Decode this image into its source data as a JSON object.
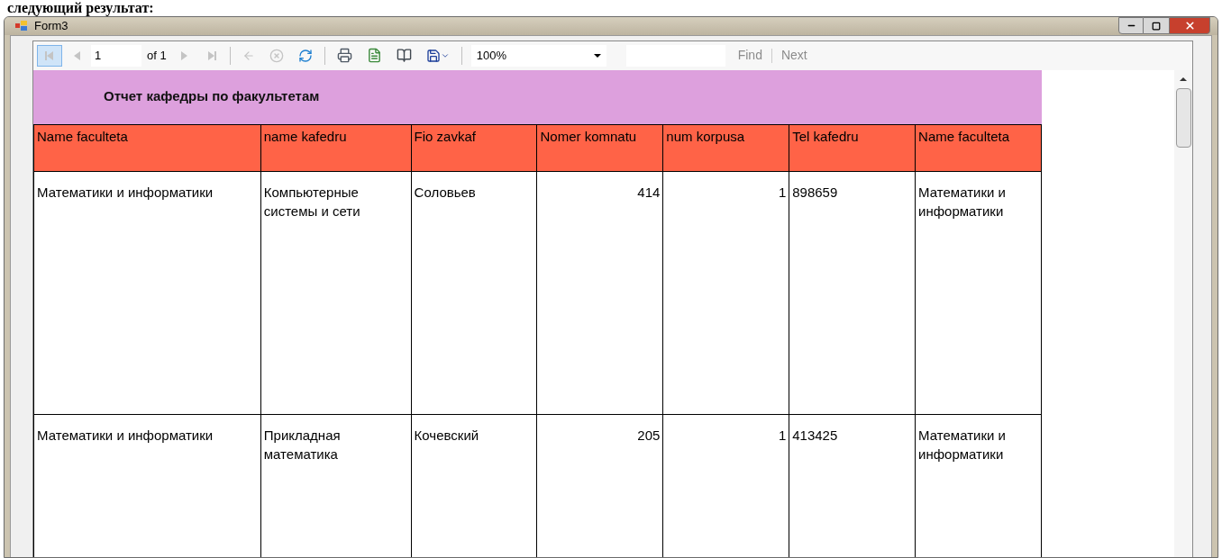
{
  "page_caption": "следующий результат:",
  "window": {
    "title": "Form3"
  },
  "toolbar": {
    "nav_buttons": [
      {
        "kind": "first",
        "disabled": true,
        "highlighted": true
      },
      {
        "kind": "prev",
        "disabled": true,
        "highlighted": false
      }
    ],
    "page_number": "1",
    "page_count": "of 1",
    "buttons": [
      {
        "kind": "next",
        "disabled": true
      },
      {
        "kind": "last",
        "disabled": true
      },
      {
        "kind": "separator"
      },
      {
        "kind": "back",
        "disabled": true
      },
      {
        "kind": "stop",
        "disabled": true
      },
      {
        "kind": "refresh",
        "disabled": false
      },
      {
        "kind": "separator"
      },
      {
        "kind": "print",
        "disabled": false
      },
      {
        "kind": "layout",
        "disabled": false
      },
      {
        "kind": "page_setup",
        "disabled": false
      },
      {
        "kind": "export",
        "disabled": false
      },
      {
        "kind": "separator"
      }
    ],
    "zoom": "100%",
    "find": "Find",
    "next": "Next",
    "find_disabled": true
  },
  "report": {
    "title": "Отчет кафедры по факультетам",
    "columns": [
      {
        "label": "Name faculteta",
        "kind": "text"
      },
      {
        "label": "name kafedru",
        "kind": "text"
      },
      {
        "label": "Fio zavkaf",
        "kind": "text"
      },
      {
        "label": "Nomer komnatu",
        "kind": "number"
      },
      {
        "label": "num korpusa",
        "kind": "number"
      },
      {
        "label": "Tel kafedru",
        "kind": "text"
      },
      {
        "label": "Name faculteta",
        "kind": "text"
      }
    ],
    "rows": [
      [
        "Математики и информатики",
        "Компьютерные системы и сети",
        "Соловьев",
        "414",
        "1",
        "898659",
        "Математики и информатики"
      ],
      [
        "Математики и информатики",
        "Прикладная математика",
        "Кочевский",
        "205",
        "1",
        "413425",
        "Математики и информатики"
      ]
    ]
  }
}
